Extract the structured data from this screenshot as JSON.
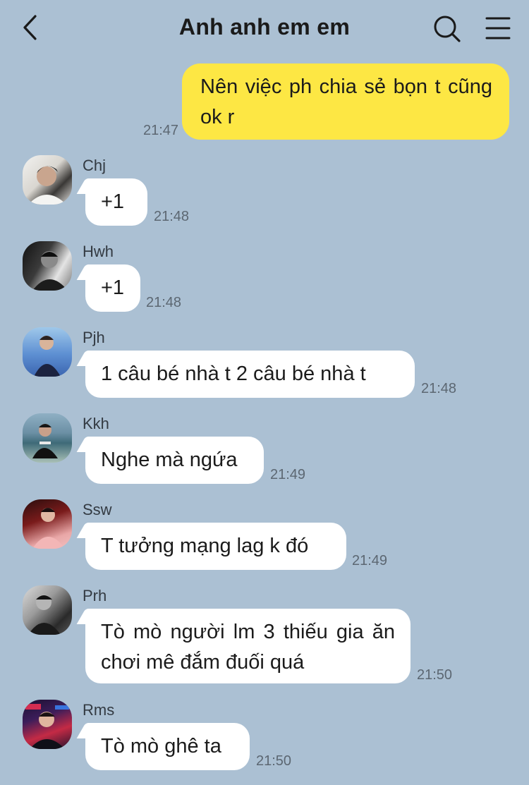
{
  "header": {
    "title": "Anh anh em em",
    "back_icon": "chevron-left-icon",
    "search_icon": "search-icon",
    "menu_icon": "menu-icon"
  },
  "outgoing": {
    "text": "Nên việc ph chia sẻ bọn t cũng ok r",
    "time": "21:47",
    "color": "#fde744"
  },
  "messages": [
    {
      "sender": "Chj",
      "text": "+1",
      "time": "21:48"
    },
    {
      "sender": "Hwh",
      "text": "+1",
      "time": "21:48"
    },
    {
      "sender": "Pjh",
      "text": "1 câu bé nhà t 2 câu bé nhà t",
      "time": "21:48"
    },
    {
      "sender": "Kkh",
      "text": "Nghe mà ngứa",
      "time": "21:49"
    },
    {
      "sender": "Ssw",
      "text": "T tưởng mạng lag k đó",
      "time": "21:49"
    },
    {
      "sender": "Prh",
      "text": "Tò mò người lm 3 thiếu gia ăn chơi mê đắm đuối quá",
      "time": "21:50"
    },
    {
      "sender": "Rms",
      "text": "Tò mò ghê ta",
      "time": "21:50"
    }
  ],
  "theme": {
    "background": "#abc0d3",
    "incoming_bubble": "#ffffff"
  }
}
